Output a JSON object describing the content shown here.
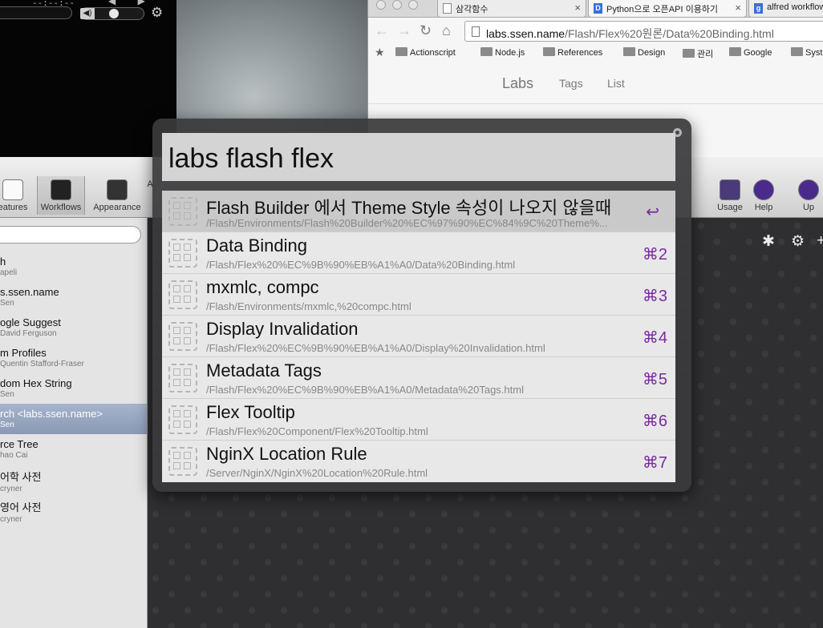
{
  "player": {
    "time": "--:--:--",
    "arrows": "◀ ▶"
  },
  "browser": {
    "tabs": [
      {
        "label": "삼각함수",
        "close": "×"
      },
      {
        "label": "Python으로 오픈API 이용하기",
        "close": "×"
      },
      {
        "label": "alfred workflow",
        "close": ""
      }
    ],
    "url_host": "labs.ssen.name",
    "url_path": "/Flash/Flex%20원론/Data%20Binding.html",
    "bookmarks": [
      "Actionscript",
      "Node.js",
      "References",
      "Design",
      "관리",
      "Google",
      "Syst"
    ],
    "site_nav": {
      "brand": "Labs",
      "tags": "Tags",
      "list": "List"
    }
  },
  "prefs": {
    "toolbar": [
      "eatures",
      "Workflows",
      "Appearance",
      "A",
      "Usage",
      "Help",
      "Up"
    ],
    "workflows": [
      {
        "name": "h",
        "author": "apeli"
      },
      {
        "name": "s.ssen.name",
        "author": "Sen"
      },
      {
        "name": "ogle Suggest",
        "author": "David Ferguson"
      },
      {
        "name": "m Profiles",
        "author": "Quentin Stafford-Fraser"
      },
      {
        "name": "dom Hex String",
        "author": "Sen"
      },
      {
        "name": "rch <labs.ssen.name>",
        "author": "Sen",
        "selected": true
      },
      {
        "name": "rce Tree",
        "author": "hao Cai"
      },
      {
        "name": "어학 사전",
        "author": "cryner"
      },
      {
        "name": "영어 사전",
        "author": "cryner"
      }
    ]
  },
  "alfred": {
    "query": "labs flash flex",
    "results": [
      {
        "title": "Flash Builder 에서 Theme Style 속성이 나오지 않을때",
        "subtitle": "/Flash/Environments/Flash%20Builder%20%EC%97%90%EC%84%9C%20Theme%...",
        "shortcut": "↩",
        "selected": true
      },
      {
        "title": "Data Binding",
        "subtitle": "/Flash/Flex%20%EC%9B%90%EB%A1%A0/Data%20Binding.html",
        "shortcut": "⌘2"
      },
      {
        "title": "mxmlc, compc",
        "subtitle": "/Flash/Environments/mxmlc,%20compc.html",
        "shortcut": "⌘3"
      },
      {
        "title": "Display Invalidation",
        "subtitle": "/Flash/Flex%20%EC%9B%90%EB%A1%A0/Display%20Invalidation.html",
        "shortcut": "⌘4"
      },
      {
        "title": "Metadata Tags",
        "subtitle": "/Flash/Flex%20%EC%9B%90%EB%A1%A0/Metadata%20Tags.html",
        "shortcut": "⌘5"
      },
      {
        "title": "Flex Tooltip",
        "subtitle": "/Flash/Flex%20Component/Flex%20Tooltip.html",
        "shortcut": "⌘6"
      },
      {
        "title": "NginX Location Rule",
        "subtitle": "/Server/NginX/NginX%20Location%20Rule.html",
        "shortcut": "⌘7"
      }
    ]
  },
  "colors": {
    "accent_purple": "#7a2aa0",
    "selection_blue": "#8a99b4"
  }
}
